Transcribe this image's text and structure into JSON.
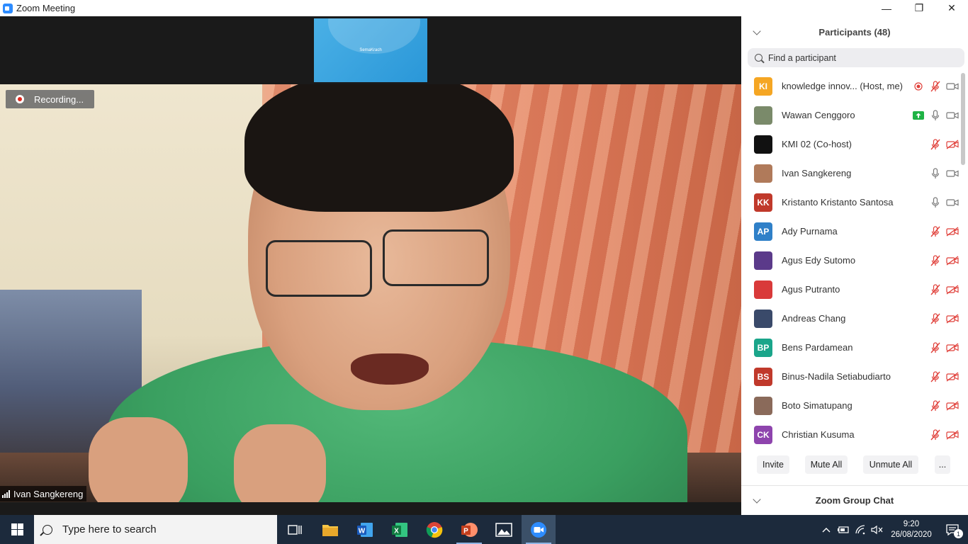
{
  "window": {
    "title": "Zoom Meeting",
    "minimize": "—",
    "maximize": "❐",
    "close": "✕"
  },
  "video": {
    "thumbnail_text": "SemaKrach",
    "recording_label": "Recording...",
    "speaker_name": "Ivan Sangkereng"
  },
  "participants": {
    "title": "Participants (48)",
    "search_placeholder": "Find a participant",
    "list": [
      {
        "name": "knowledge innov... (Host, me)",
        "initials": "KI",
        "color": "#f5a623",
        "mic": "muted",
        "video": "on",
        "extra": "record"
      },
      {
        "name": "Wawan Cenggoro",
        "initials": "",
        "color": "#7a8a6a",
        "mic": "on",
        "video": "on",
        "extra": "share"
      },
      {
        "name": "KMI 02 (Co-host)",
        "initials": "",
        "color": "#111111",
        "mic": "muted",
        "video": "off",
        "extra": ""
      },
      {
        "name": "Ivan Sangkereng",
        "initials": "",
        "color": "#b07a5a",
        "mic": "on",
        "video": "on",
        "extra": ""
      },
      {
        "name": "Kristanto Kristanto Santosa",
        "initials": "KK",
        "color": "#c0392b",
        "mic": "on",
        "video": "on",
        "extra": ""
      },
      {
        "name": "Ady Purnama",
        "initials": "AP",
        "color": "#2f80c8",
        "mic": "muted",
        "video": "off",
        "extra": ""
      },
      {
        "name": "Agus Edy Sutomo",
        "initials": "",
        "color": "#5b3a8a",
        "mic": "muted",
        "video": "off",
        "extra": ""
      },
      {
        "name": "Agus Putranto",
        "initials": "",
        "color": "#d93a3a",
        "mic": "muted",
        "video": "off",
        "extra": ""
      },
      {
        "name": "Andreas Chang",
        "initials": "",
        "color": "#3a4a6a",
        "mic": "muted",
        "video": "off",
        "extra": ""
      },
      {
        "name": "Bens Pardamean",
        "initials": "BP",
        "color": "#1aa58a",
        "mic": "muted",
        "video": "off",
        "extra": ""
      },
      {
        "name": "Binus-Nadila Setiabudiarto",
        "initials": "BS",
        "color": "#c0392b",
        "mic": "muted",
        "video": "off",
        "extra": ""
      },
      {
        "name": "Boto Simatupang",
        "initials": "",
        "color": "#8a6a5a",
        "mic": "muted",
        "video": "off",
        "extra": ""
      },
      {
        "name": "Christian Kusuma",
        "initials": "CK",
        "color": "#8e44ad",
        "mic": "muted",
        "video": "off",
        "extra": ""
      }
    ],
    "buttons": {
      "invite": "Invite",
      "mute_all": "Mute All",
      "unmute_all": "Unmute All",
      "more": "..."
    }
  },
  "chat": {
    "title": "Zoom Group Chat"
  },
  "taskbar": {
    "search_placeholder": "Type here to search",
    "time": "9:20",
    "date": "26/08/2020",
    "notification_count": "1",
    "apps": [
      "task-view",
      "file-explorer",
      "word",
      "excel",
      "chrome",
      "powerpoint",
      "photos",
      "zoom"
    ]
  }
}
